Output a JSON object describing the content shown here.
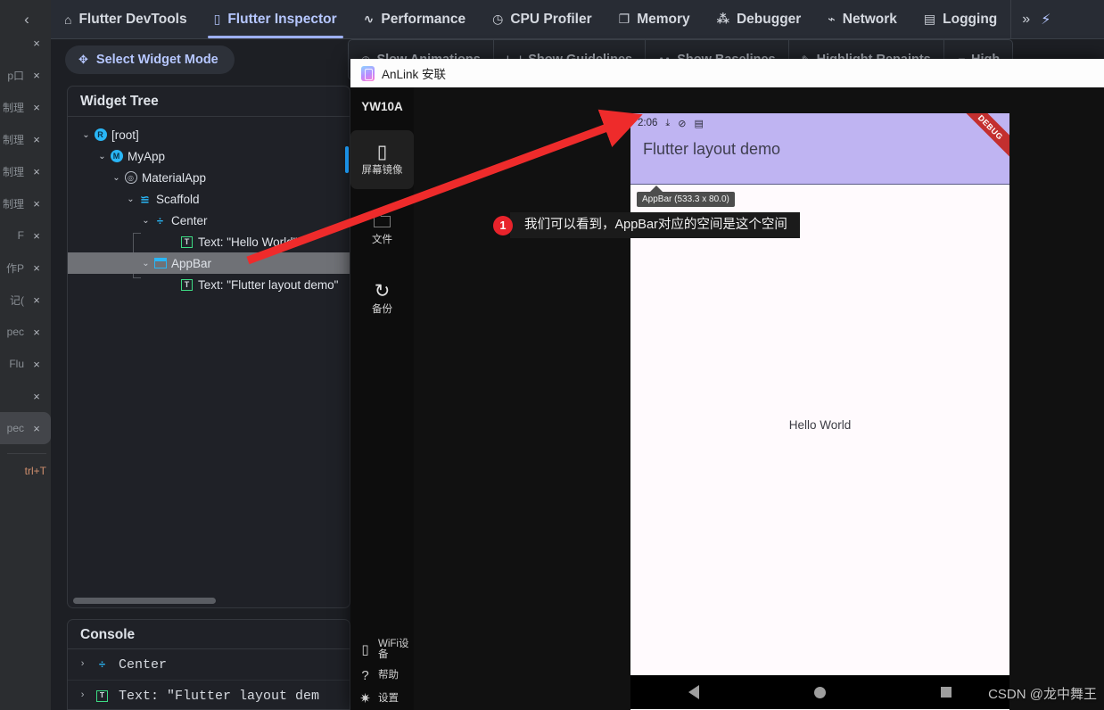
{
  "ide": {
    "collapse_icon": "‹",
    "rail_items": [
      {
        "label": "",
        "close": "×"
      },
      {
        "label": "p口",
        "close": "×"
      },
      {
        "label": "制理",
        "close": "×"
      },
      {
        "label": "制理",
        "close": "×"
      },
      {
        "label": "制理",
        "close": "×"
      },
      {
        "label": "制理",
        "close": "×"
      },
      {
        "label": "F",
        "close": "×"
      },
      {
        "label": "作P",
        "close": "×"
      },
      {
        "label": "记(",
        "close": "×"
      },
      {
        "label": "pec",
        "close": "×"
      },
      {
        "label": "Flu",
        "close": "×"
      },
      {
        "label": "",
        "close": "×"
      },
      {
        "label": "pec",
        "close": "×"
      }
    ],
    "rail_hint": "trl+T"
  },
  "devtools": {
    "tabs": [
      {
        "label": "Flutter DevTools",
        "icon": "home-icon",
        "glyph": "⌂",
        "selected": false
      },
      {
        "label": "Flutter Inspector",
        "icon": "phone-icon",
        "glyph": "▯",
        "selected": true
      },
      {
        "label": "Performance",
        "icon": "pulse-icon",
        "glyph": "∿",
        "selected": false
      },
      {
        "label": "CPU Profiler",
        "icon": "gauge-icon",
        "glyph": "◷",
        "selected": false
      },
      {
        "label": "Memory",
        "icon": "cube-icon",
        "glyph": "❐",
        "selected": false
      },
      {
        "label": "Debugger",
        "icon": "bug-icon",
        "glyph": "⁂",
        "selected": false
      },
      {
        "label": "Network",
        "icon": "wifi-icon",
        "glyph": "⌁",
        "selected": false
      },
      {
        "label": "Logging",
        "icon": "log-icon",
        "glyph": "▤",
        "selected": false
      }
    ],
    "overflow_glyph": "»",
    "hot_reload_glyph": "⚡",
    "select_widget_mode": "Select Widget Mode",
    "select_widget_icon_glyph": "✥",
    "tools": [
      {
        "label": "Slow Animations",
        "glyph": "◷"
      },
      {
        "label": "Show Guidelines",
        "glyph": "⊦⊣"
      },
      {
        "label": "Show Baselines",
        "glyph": "ᴀᴀ"
      },
      {
        "label": "Highlight Repaints",
        "glyph": "✎"
      },
      {
        "label": "High",
        "glyph": "▰"
      }
    ],
    "widget_tree": {
      "title": "Widget Tree",
      "rows": [
        {
          "chev": "⌄",
          "icon": "root-icon",
          "icon_kind": "circle",
          "icon_text": "R",
          "label": "[root]",
          "indent": 14,
          "selected": false
        },
        {
          "chev": "⌄",
          "icon": "myapp-icon",
          "icon_kind": "circle",
          "icon_text": "M",
          "label": "MyApp",
          "indent": 32,
          "selected": false
        },
        {
          "chev": "⌄",
          "icon": "materialapp-icon",
          "icon_kind": "ring",
          "icon_text": "◎",
          "label": "MaterialApp",
          "indent": 48,
          "selected": false
        },
        {
          "chev": "⌄",
          "icon": "scaffold-icon",
          "icon_kind": "scaffold",
          "icon_text": "≊",
          "label": "Scaffold",
          "indent": 64,
          "selected": false
        },
        {
          "chev": "⌄",
          "icon": "center-icon",
          "icon_kind": "center",
          "icon_text": "÷",
          "label": "Center",
          "indent": 81,
          "selected": false
        },
        {
          "chev": "",
          "icon": "text-icon",
          "icon_kind": "sq-green",
          "icon_text": "T",
          "label": "Text: \"Hello World\"",
          "indent": 111,
          "selected": false
        },
        {
          "chev": "⌄",
          "icon": "appbar-icon",
          "icon_kind": "sq-blue",
          "icon_text": "",
          "label": "AppBar",
          "indent": 81,
          "selected": true
        },
        {
          "chev": "",
          "icon": "text-icon",
          "icon_kind": "sq-green",
          "icon_text": "T",
          "label": "Text: \"Flutter layout demo\"",
          "indent": 111,
          "selected": false
        }
      ]
    },
    "console": {
      "title": "Console",
      "rows": [
        {
          "chev": "›",
          "icon_kind": "center",
          "icon_text": "÷",
          "label": "Center"
        },
        {
          "chev": "›",
          "icon_kind": "sq-green",
          "icon_text": "T",
          "label": "Text: \"Flutter layout dem"
        }
      ]
    }
  },
  "anlink": {
    "window_title": "AnLink 安联",
    "device_name": "YW10A",
    "nav_items": [
      {
        "label": "屏幕镜像",
        "icon": "phone-mirror-icon",
        "glyph": "▯",
        "active": true
      },
      {
        "label": "文件",
        "icon": "folder-icon",
        "glyph": "🗀",
        "active": false
      },
      {
        "label": "备份",
        "icon": "sync-icon",
        "glyph": "↻",
        "active": false
      }
    ],
    "bottom_items": [
      {
        "label": "WiFi设备",
        "icon": "wifi-device-icon",
        "glyph": "▯"
      },
      {
        "label": "帮助",
        "icon": "help-icon",
        "glyph": "?"
      },
      {
        "label": "设置",
        "icon": "settings-icon",
        "glyph": "✷"
      }
    ],
    "phone": {
      "status_time": "2:06",
      "status_icons": [
        {
          "name": "download-icon",
          "glyph": "⤓"
        },
        {
          "name": "mute-icon",
          "glyph": "⊘"
        },
        {
          "name": "document-icon",
          "glyph": "▤"
        }
      ],
      "appbar_title": "Flutter layout demo",
      "appbar_color": "#bfb4f2",
      "debug_banner": "DEBUG",
      "inspector_tooltip": "AppBar (533.3 x 80.0)",
      "body_text": "Hello World",
      "nav_buttons": [
        {
          "name": "nav-back-button"
        },
        {
          "name": "nav-home-button"
        },
        {
          "name": "nav-recents-button"
        }
      ]
    }
  },
  "annotation": {
    "number": "1",
    "text": "我们可以看到，AppBar对应的空间是这个空间",
    "arrow_color": "#ee2b2b"
  },
  "watermark": "CSDN @龙中舞王"
}
